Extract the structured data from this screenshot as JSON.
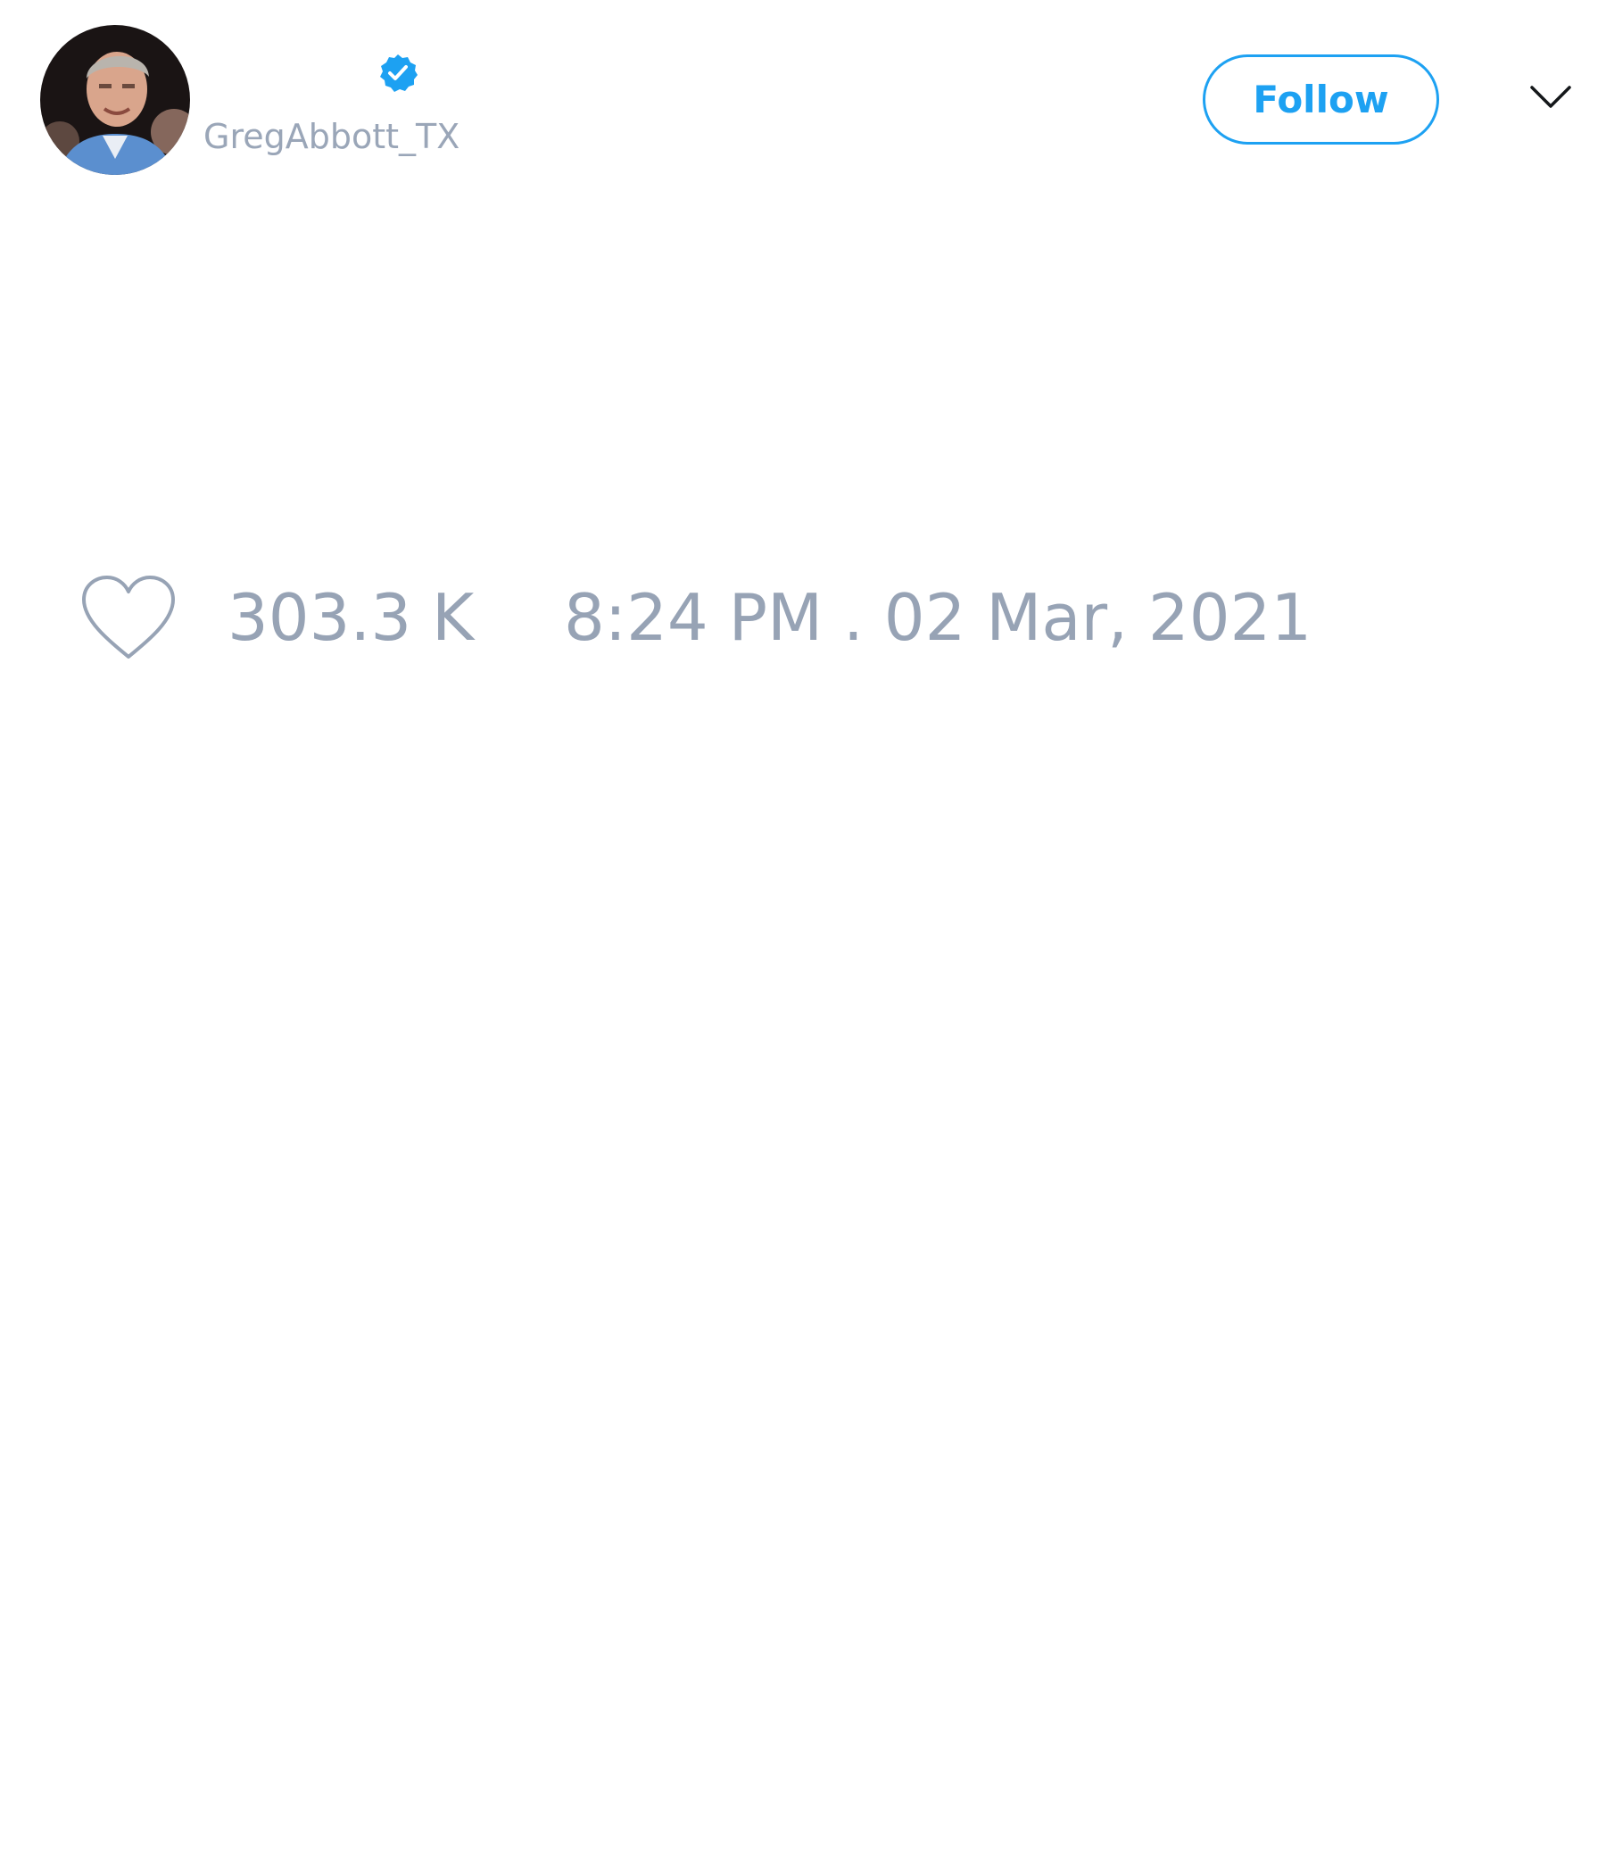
{
  "tweet": {
    "author": {
      "handle": "GregAbbott_TX",
      "verified": true,
      "avatar": "profile-photo"
    },
    "follow_button_label": "Follow",
    "menu_icon": "chevron-down-icon",
    "likes": {
      "icon": "heart-outline-icon",
      "count": "303.3 K"
    },
    "timestamp": "8:24 PM . 02 Mar, 2021"
  },
  "colors": {
    "accent": "#1da1f2",
    "muted_text": "#97a3b5",
    "background": "#ffffff"
  }
}
